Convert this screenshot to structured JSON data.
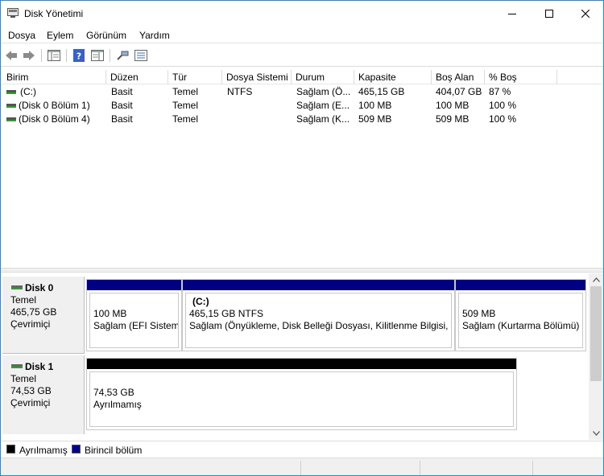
{
  "window": {
    "title": "Disk Yönetimi"
  },
  "menu": [
    "Dosya",
    "Eylem",
    "Görünüm",
    "Yardım"
  ],
  "toolbar": {
    "icons": [
      "back-icon",
      "forward-icon",
      "console-tree-icon",
      "help-icon",
      "properties-icon",
      "connect-icon",
      "list-view-icon"
    ]
  },
  "volume_list": {
    "columns": [
      "Birim",
      "Düzen",
      "Tür",
      "Dosya Sistemi",
      "Durum",
      "Kapasite",
      "Boş Alan",
      "% Boş"
    ],
    "rows": [
      {
        "birim": "(C:)",
        "duzen": "Basit",
        "tur": "Temel",
        "dosya_sistemi": "NTFS",
        "durum": "Sağlam (Ö...",
        "kapasite": "465,15 GB",
        "bos_alan": "404,07 GB",
        "yuzde_bos": "87 %"
      },
      {
        "birim": "(Disk 0 Bölüm 1)",
        "duzen": "Basit",
        "tur": "Temel",
        "dosya_sistemi": "",
        "durum": "Sağlam (E...",
        "kapasite": "100 MB",
        "bos_alan": "100 MB",
        "yuzde_bos": "100 %"
      },
      {
        "birim": "(Disk 0 Bölüm 4)",
        "duzen": "Basit",
        "tur": "Temel",
        "dosya_sistemi": "",
        "durum": "Sağlam (K...",
        "kapasite": "509 MB",
        "bos_alan": "509 MB",
        "yuzde_bos": "100 %"
      }
    ]
  },
  "disks": [
    {
      "name": "Disk 0",
      "type": "Temel",
      "size": "465,75 GB",
      "status": "Çevrimiçi",
      "partitions": [
        {
          "label": "",
          "size": "100 MB",
          "status": "Sağlam (EFI Sistem",
          "kind": "primary"
        },
        {
          "label": "(C:)",
          "size": "465,15 GB NTFS",
          "status": "Sağlam (Önyükleme, Disk Belleği Dosyası, Kilitlenme Bilgisi, Te",
          "kind": "primary"
        },
        {
          "label": "",
          "size": "509 MB",
          "status": "Sağlam (Kurtarma Bölümü)",
          "kind": "primary"
        }
      ]
    },
    {
      "name": "Disk 1",
      "type": "Temel",
      "size": "74,53 GB",
      "status": "Çevrimiçi",
      "partitions": [
        {
          "label": "",
          "size": "74,53 GB",
          "status": "Ayrılmamış",
          "kind": "unallocated"
        }
      ]
    }
  ],
  "legend": [
    {
      "label": "Ayrılmamış",
      "color": "#000000"
    },
    {
      "label": "Birincil bölüm",
      "color": "#00008b"
    }
  ],
  "colors": {
    "primary": "#000080",
    "unallocated": "#000000",
    "accent": "#1e88e5"
  }
}
